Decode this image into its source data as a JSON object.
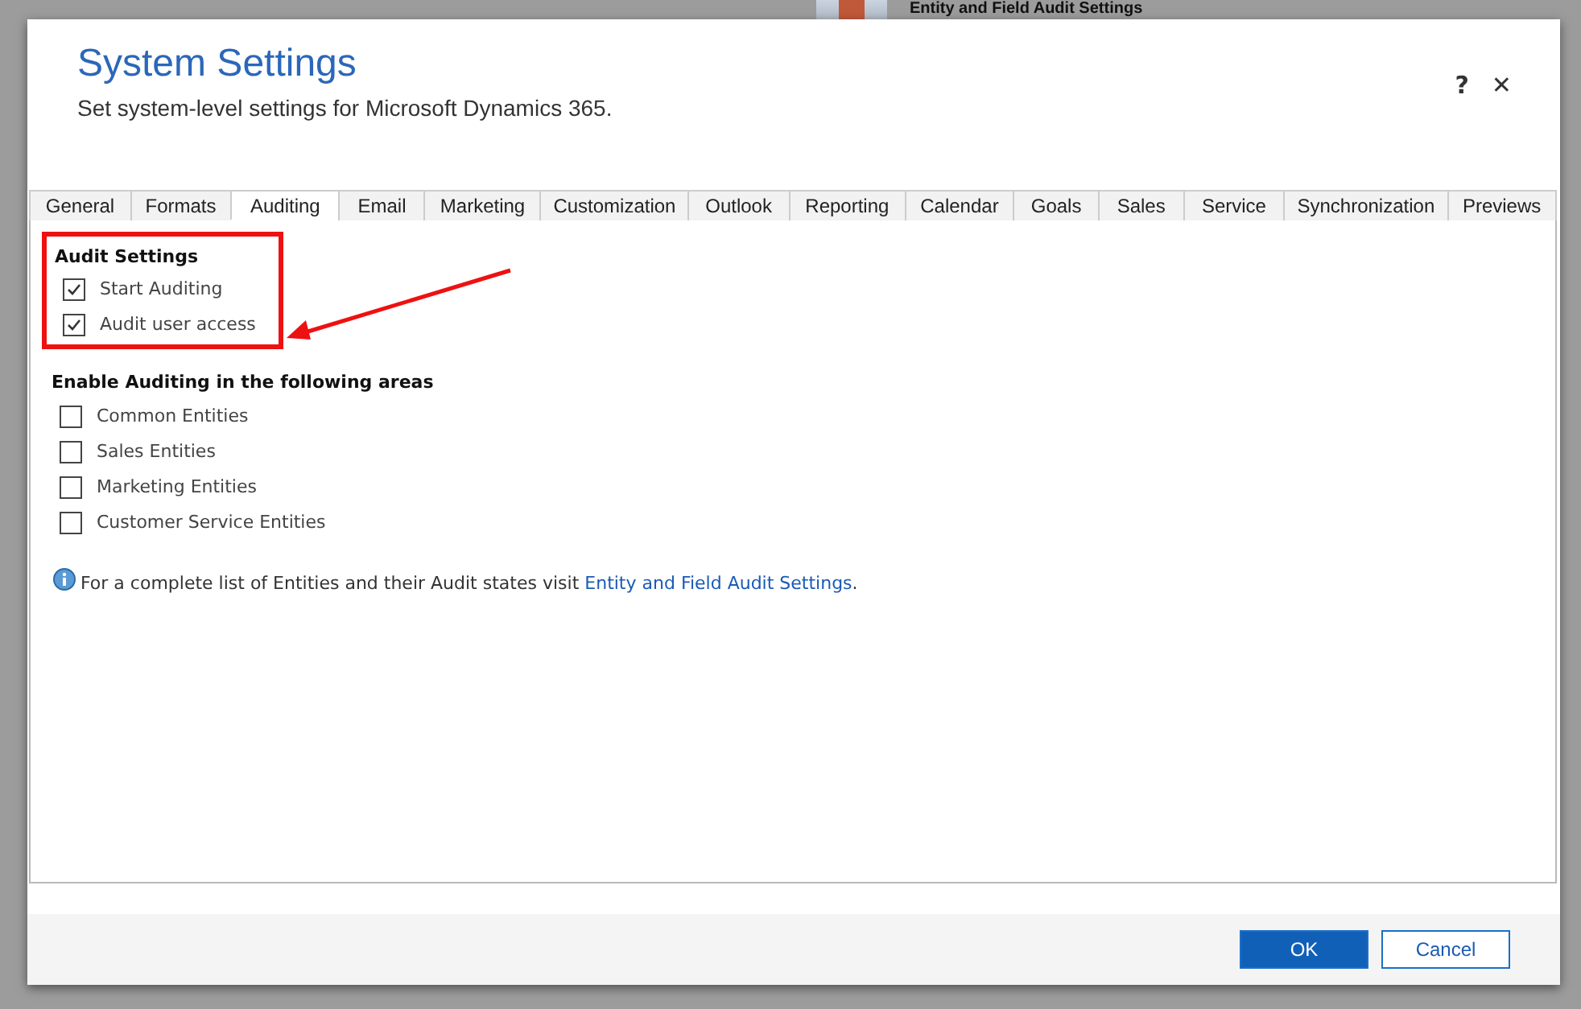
{
  "background": {
    "title": "Entity and Field Audit Settings"
  },
  "dialog": {
    "title": "System Settings",
    "subtitle": "Set system-level settings for Microsoft Dynamics 365.",
    "help": "?",
    "close": "✕"
  },
  "tabs": [
    {
      "label": "General",
      "selected": false
    },
    {
      "label": "Formats",
      "selected": false
    },
    {
      "label": "Auditing",
      "selected": true
    },
    {
      "label": "Email",
      "selected": false
    },
    {
      "label": "Marketing",
      "selected": false
    },
    {
      "label": "Customization",
      "selected": false
    },
    {
      "label": "Outlook",
      "selected": false
    },
    {
      "label": "Reporting",
      "selected": false
    },
    {
      "label": "Calendar",
      "selected": false
    },
    {
      "label": "Goals",
      "selected": false
    },
    {
      "label": "Sales",
      "selected": false
    },
    {
      "label": "Service",
      "selected": false
    },
    {
      "label": "Synchronization",
      "selected": false
    },
    {
      "label": "Previews",
      "selected": false
    }
  ],
  "audit_settings": {
    "heading": "Audit Settings",
    "items": [
      {
        "label": "Start Auditing",
        "checked": true
      },
      {
        "label": "Audit user access",
        "checked": true
      }
    ]
  },
  "areas": {
    "heading": "Enable Auditing in the following areas",
    "items": [
      {
        "label": "Common Entities",
        "checked": false
      },
      {
        "label": "Sales Entities",
        "checked": false
      },
      {
        "label": "Marketing Entities",
        "checked": false
      },
      {
        "label": "Customer Service Entities",
        "checked": false
      }
    ]
  },
  "info": {
    "text": "For a complete list of Entities and their Audit states visit",
    "link": "Entity and Field Audit Settings",
    "after": "."
  },
  "buttons": [
    {
      "label": "OK",
      "kind": "primary"
    },
    {
      "label": "Cancel",
      "kind": "secondary"
    }
  ]
}
